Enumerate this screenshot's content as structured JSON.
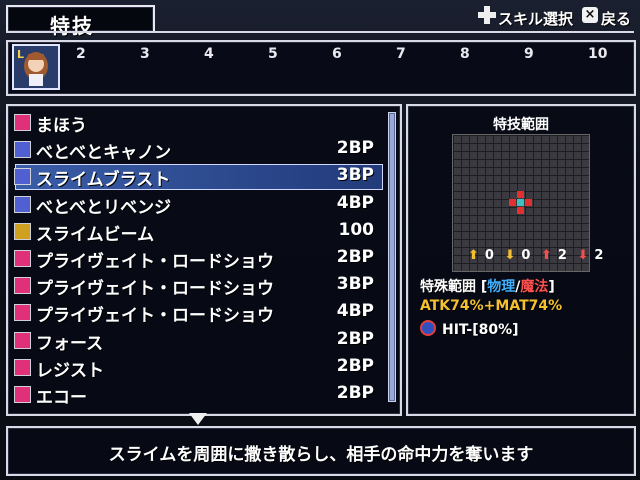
{
  "header": {
    "title": "特技",
    "skill_select": "スキル選択",
    "back": "戻る"
  },
  "party": {
    "slots": [
      "2",
      "3",
      "4",
      "5",
      "6",
      "7",
      "8",
      "9",
      "10"
    ],
    "leader_badge": "L"
  },
  "skills": [
    {
      "name": "まほう",
      "cost": "",
      "icon": "magic-book-icon",
      "color": "#e0307a"
    },
    {
      "name": "べとべとキャノン",
      "cost": "2BP",
      "icon": "skill-blue-icon",
      "color": "#5060d0"
    },
    {
      "name": "スライムブラスト",
      "cost": "3BP",
      "icon": "skill-blue-icon",
      "color": "#5060d0"
    },
    {
      "name": "べとべとリベンジ",
      "cost": "4BP",
      "icon": "skill-blue-icon",
      "color": "#5060d0"
    },
    {
      "name": "スライムビーム",
      "cost": "100",
      "icon": "beam-icon",
      "color": "#d0a020"
    },
    {
      "name": "プライヴェイト・ロードショウ",
      "cost": "2BP",
      "icon": "music-icon",
      "color": "#e0307a"
    },
    {
      "name": "プライヴェイト・ロードショウ",
      "cost": "3BP",
      "icon": "music-plus1-icon",
      "color": "#e0307a"
    },
    {
      "name": "プライヴェイト・ロードショウ",
      "cost": "4BP",
      "icon": "music-plus2-icon",
      "color": "#e0307a"
    },
    {
      "name": "フォース",
      "cost": "2BP",
      "icon": "vo-icon",
      "color": "#e0307a"
    },
    {
      "name": "レジスト",
      "cost": "2BP",
      "icon": "vo-icon",
      "color": "#e0307a"
    },
    {
      "name": "エコー",
      "cost": "2BP",
      "icon": "vo-icon",
      "color": "#e0307a"
    }
  ],
  "selected_index": 2,
  "range": {
    "title": "特技範囲",
    "mods": [
      "0",
      "0",
      "2",
      "2"
    ],
    "type_prefix": "特殊範囲 [",
    "physical": "物理",
    "slash": "/",
    "magic": "魔法",
    "type_suffix": "]",
    "atk_text": "ATK74%+MAT74%",
    "hit_text": "HIT-[80%]"
  },
  "description": "スライムを周囲に撒き散らし、相手の命中力を奪います"
}
